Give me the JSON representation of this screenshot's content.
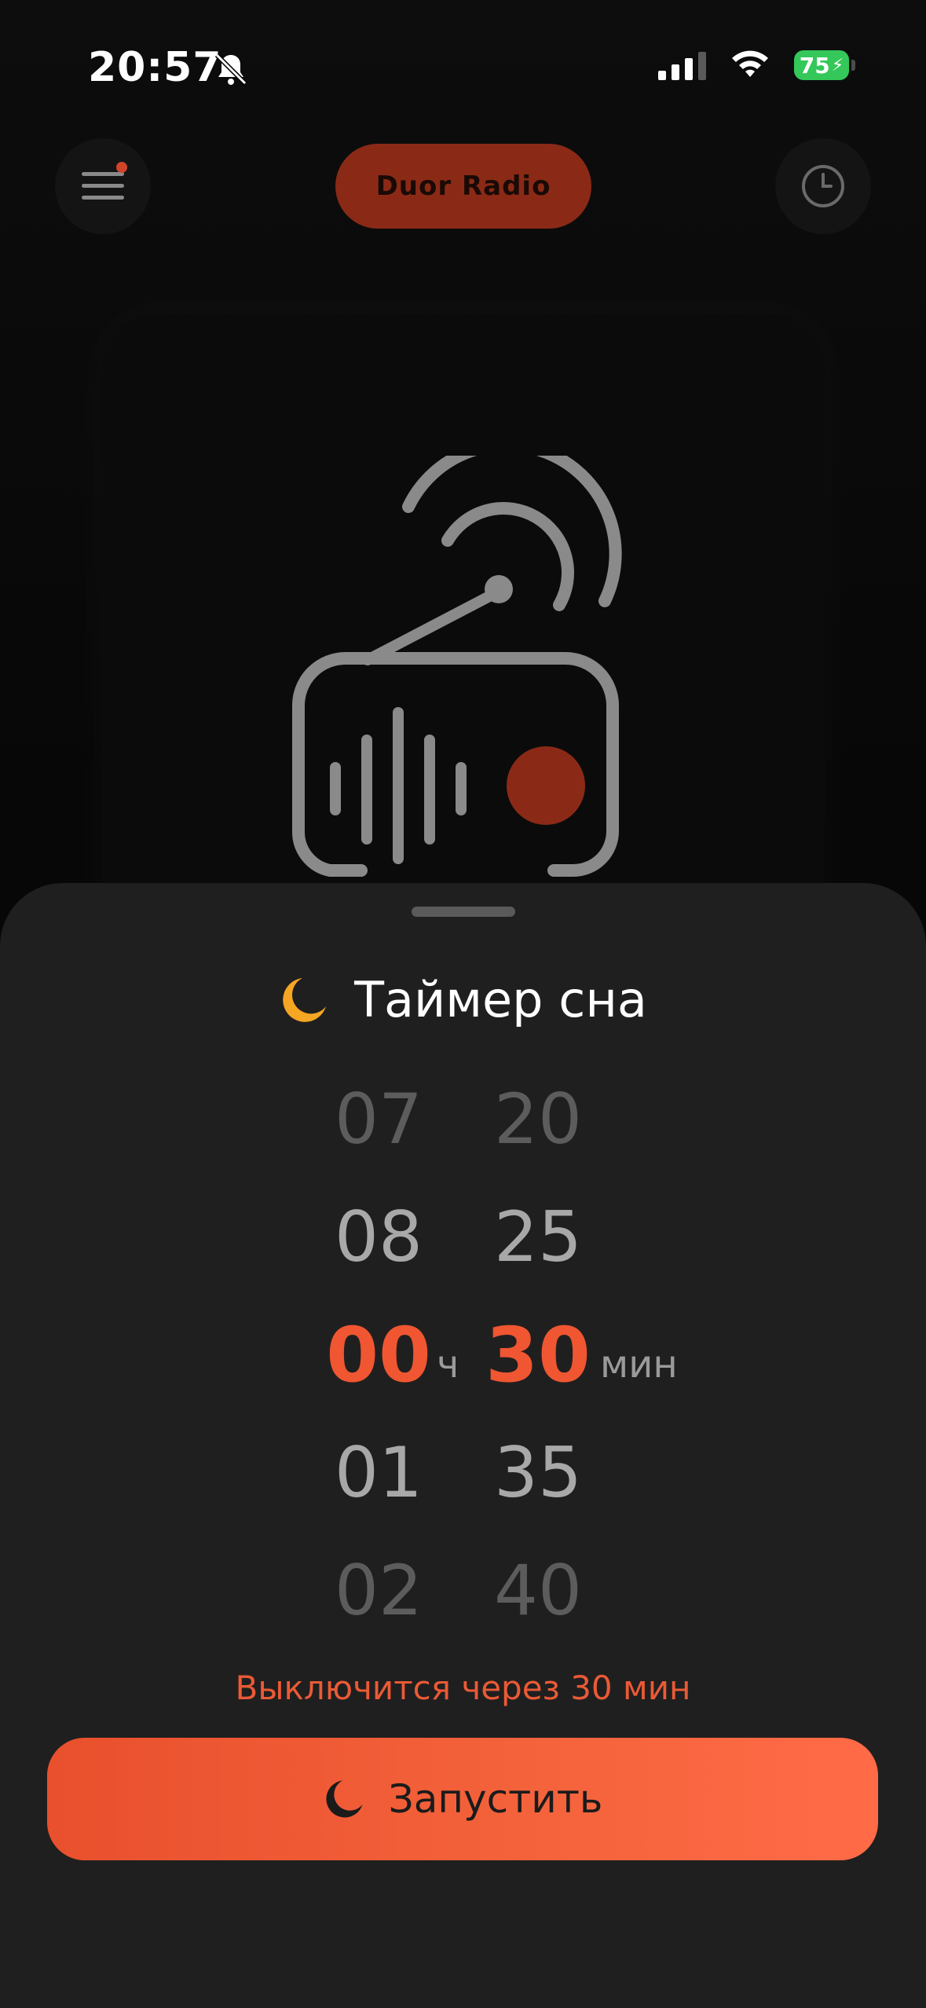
{
  "status_bar": {
    "time": "20:57",
    "battery": "75"
  },
  "header": {
    "brand": "Duor Radio"
  },
  "sleep_timer": {
    "title": "Таймер сна",
    "hours": [
      "07",
      "08",
      "00",
      "01",
      "02"
    ],
    "minutes": [
      "20",
      "25",
      "30",
      "35",
      "40"
    ],
    "hours_unit": "ч",
    "minutes_unit": "мин",
    "hint": "Выключится через 30 мин",
    "start_label": "Запустить"
  },
  "colors": {
    "accent": "#ef5631",
    "moon": "#f5a623",
    "sheet_bg": "#201f1f"
  }
}
